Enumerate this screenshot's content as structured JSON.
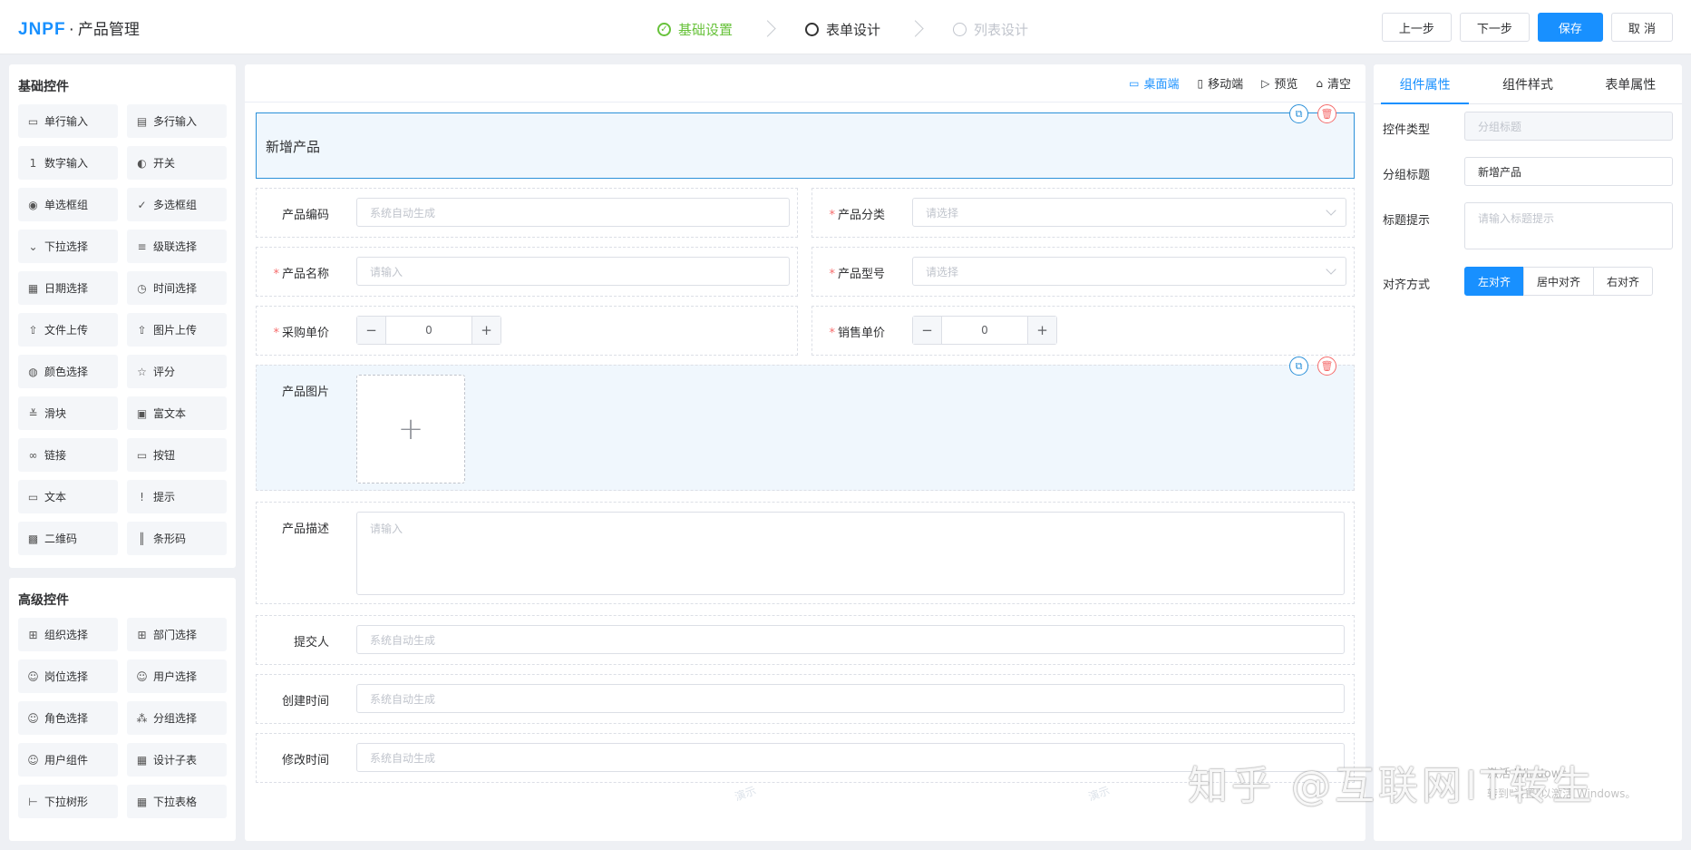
{
  "header": {
    "logo": "JNPF",
    "dot": "·",
    "title": "产品管理",
    "steps": [
      {
        "label": "基础设置",
        "state": "done"
      },
      {
        "label": "表单设计",
        "state": "active"
      },
      {
        "label": "列表设计",
        "state": "pending"
      }
    ],
    "buttons": {
      "prev": "上一步",
      "next": "下一步",
      "save": "保存",
      "cancel": "取 消"
    }
  },
  "basic_controls": {
    "title": "基础控件",
    "items": [
      {
        "label": "单行输入",
        "icon": "▭"
      },
      {
        "label": "多行输入",
        "icon": "▤"
      },
      {
        "label": "数字输入",
        "icon": "1"
      },
      {
        "label": "开关",
        "icon": "◐"
      },
      {
        "label": "单选框组",
        "icon": "◉"
      },
      {
        "label": "多选框组",
        "icon": "✓"
      },
      {
        "label": "下拉选择",
        "icon": "⌄"
      },
      {
        "label": "级联选择",
        "icon": "≡"
      },
      {
        "label": "日期选择",
        "icon": "▦"
      },
      {
        "label": "时间选择",
        "icon": "◷"
      },
      {
        "label": "文件上传",
        "icon": "⇧"
      },
      {
        "label": "图片上传",
        "icon": "⇧"
      },
      {
        "label": "颜色选择",
        "icon": "◍"
      },
      {
        "label": "评分",
        "icon": "☆"
      },
      {
        "label": "滑块",
        "icon": "≚"
      },
      {
        "label": "富文本",
        "icon": "▣"
      },
      {
        "label": "链接",
        "icon": "∞"
      },
      {
        "label": "按钮",
        "icon": "▭"
      },
      {
        "label": "文本",
        "icon": "▭"
      },
      {
        "label": "提示",
        "icon": "!"
      },
      {
        "label": "二维码",
        "icon": "▩"
      },
      {
        "label": "条形码",
        "icon": "║"
      }
    ]
  },
  "advanced_controls": {
    "title": "高级控件",
    "items": [
      {
        "label": "组织选择",
        "icon": "⊞"
      },
      {
        "label": "部门选择",
        "icon": "⊞"
      },
      {
        "label": "岗位选择",
        "icon": "☺"
      },
      {
        "label": "用户选择",
        "icon": "☺"
      },
      {
        "label": "角色选择",
        "icon": "☺"
      },
      {
        "label": "分组选择",
        "icon": "⁂"
      },
      {
        "label": "用户组件",
        "icon": "☺"
      },
      {
        "label": "设计子表",
        "icon": "▦"
      },
      {
        "label": "下拉树形",
        "icon": "⊢"
      },
      {
        "label": "下拉表格",
        "icon": "▦"
      }
    ]
  },
  "toolbar": {
    "desktop": "桌面端",
    "mobile": "移动端",
    "preview": "预览",
    "clear": "清空"
  },
  "form": {
    "section_title": "新增产品",
    "fields": {
      "code": {
        "label": "产品编码",
        "placeholder": "系统自动生成"
      },
      "category": {
        "label": "产品分类",
        "placeholder": "请选择"
      },
      "name": {
        "label": "产品名称",
        "placeholder": "请输入"
      },
      "model": {
        "label": "产品型号",
        "placeholder": "请选择"
      },
      "purchase_price": {
        "label": "采购单价",
        "value": "0"
      },
      "sale_price": {
        "label": "销售单价",
        "value": "0"
      },
      "image": {
        "label": "产品图片"
      },
      "description": {
        "label": "产品描述",
        "placeholder": "请输入"
      },
      "submitter": {
        "label": "提交人",
        "placeholder": "系统自动生成"
      },
      "created": {
        "label": "创建时间",
        "placeholder": "系统自动生成"
      },
      "modified": {
        "label": "修改时间",
        "placeholder": "系统自动生成"
      }
    },
    "required_mark": "*",
    "watermark": "演示"
  },
  "right_panel": {
    "tabs": [
      "组件属性",
      "组件样式",
      "表单属性"
    ],
    "control_type": {
      "label": "控件类型",
      "value": "分组标题"
    },
    "group_title": {
      "label": "分组标题",
      "value": "新增产品"
    },
    "title_hint": {
      "label": "标题提示",
      "placeholder": "请输入标题提示"
    },
    "align": {
      "label": "对齐方式",
      "options": [
        "左对齐",
        "居中对齐",
        "右对齐"
      ],
      "selected": "左对齐"
    }
  },
  "overlay": {
    "zhihu": "知乎 @互联网IT转生",
    "win_line1": "激活 Windows",
    "win_line2": "转到\"设置\"以激活 Windows。"
  },
  "colors": {
    "accent": "#1890ff",
    "success": "#67c23a",
    "danger": "#f56c6c"
  }
}
